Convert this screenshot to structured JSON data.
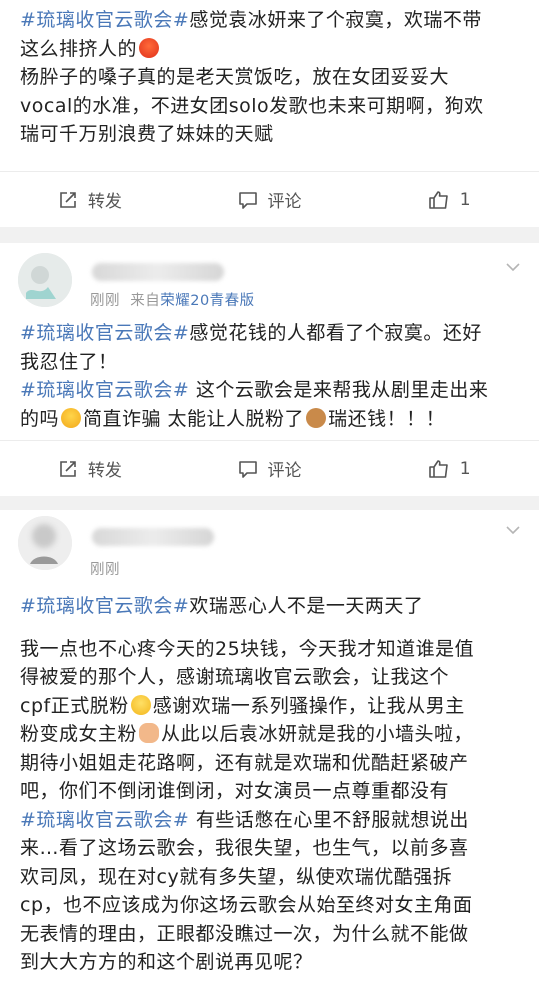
{
  "post1": {
    "tag": "#琉璃收官云歌会#",
    "line1_rest": "感觉袁冰妍来了个寂寞，欢瑞不带",
    "line2": "这么排挤人的",
    "line3": "杨肸子的嗓子真的是老天赏饭吃，放在女团妥妥大",
    "line4": "vocal的水准，不进女团solo发歌也未来可期啊，狗欢",
    "line5": "瑞可千万别浪费了妹妹的天赋"
  },
  "actions1": {
    "repost": "转发",
    "comment": "评论",
    "like_count": "1"
  },
  "post2": {
    "time": "刚刚",
    "source_prefix": "来自",
    "source": "荣耀20青春版",
    "tag1": "#琉璃收官云歌会#",
    "line1_rest": "感觉花钱的人都看了个寂寞。还好",
    "line2": "我忍住了！",
    "tag2": "#琉璃收官云歌会#",
    "line3_rest": " 这个云歌会是来帮我从剧里走出来",
    "line4_a": "的吗",
    "line4_b": "简直诈骗 太能让人脱粉了",
    "line4_c": "瑞还钱！！！"
  },
  "actions2": {
    "repost": "转发",
    "comment": "评论",
    "like_count": "1"
  },
  "post3": {
    "time": "刚刚",
    "tag1": "#琉璃收官云歌会#",
    "line1_rest": "欢瑞恶心人不是一天两天了",
    "p2_l1": "我一点也不心疼今天的25块钱，今天我才知道谁是值",
    "p2_l2": "得被爱的那个人，感谢琉璃收官云歌会，让我这个",
    "p2_l3a": "cpf正式脱粉",
    "p2_l3b": "感谢欢瑞一系列骚操作，让我从男主",
    "p2_l4a": "粉变成女主粉",
    "p2_l4b": "从此以后袁冰妍就是我的小墙头啦，",
    "p2_l5": "期待小姐姐走花路啊，还有就是欢瑞和优酷赶紧破产",
    "p2_l6": "吧，你们不倒闭谁倒闭，对女演员一点尊重都没有",
    "tag2": "#琉璃收官云歌会#",
    "p3_l1_rest": " 有些话憋在心里不舒服就想说出",
    "p3_l2": "来…看了这场云歌会，我很失望，也生气，以前多喜",
    "p3_l3": "欢司凤，现在对cy就有多失望，纵使欢瑞优酷强拆",
    "p3_l4": "cp，也不应该成为你这场云歌会从始至终对女主角面",
    "p3_l5": "无表情的理由，正眼都没瞧过一次，为什么就不能做",
    "p3_l6": "到大大方方的和这个剧说再见呢？"
  },
  "icons": [
    "repost-icon",
    "comment-icon",
    "like-icon",
    "chevron-down-icon"
  ]
}
